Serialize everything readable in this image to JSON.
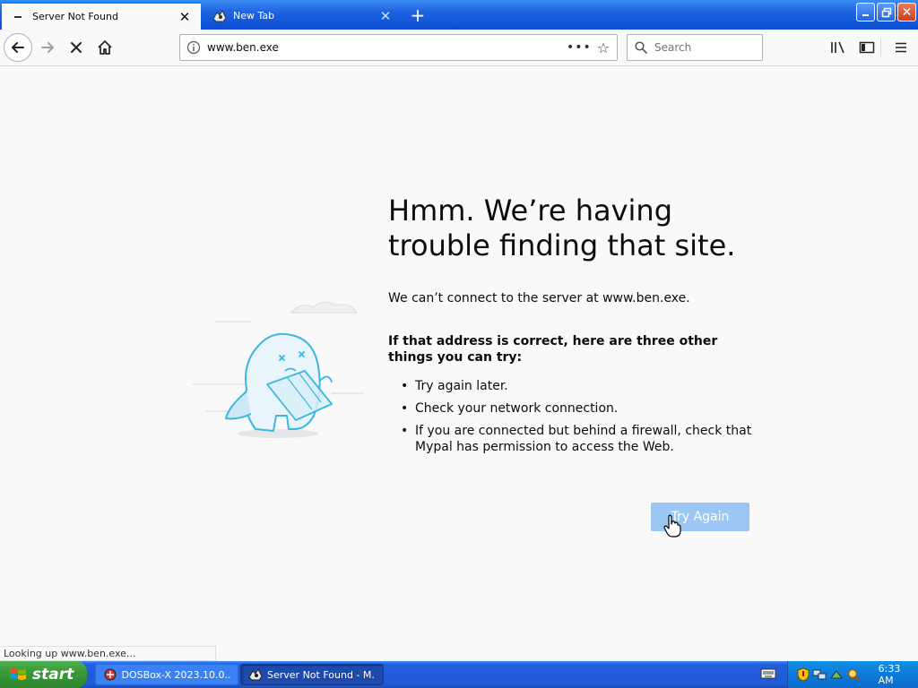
{
  "browser": {
    "tabs": [
      {
        "label": "Server Not Found",
        "active": true
      },
      {
        "label": "New Tab",
        "active": false
      }
    ],
    "new_tab_symbol": "+",
    "url": "www.ben.exe",
    "search_placeholder": "Search",
    "status_text": "Looking up www.ben.exe...",
    "icons": [
      "back-arrow-icon",
      "forward-arrow-icon",
      "stop-icon",
      "home-icon",
      "info-icon",
      "page-actions-icon",
      "bookmark-star-icon",
      "search-icon",
      "library-icon",
      "sidebar-icon",
      "hamburger-menu-icon"
    ]
  },
  "error_page": {
    "title": "Hmm. We’re having trouble finding that site.",
    "description": "We can’t connect to the server at www.ben.exe.",
    "suggestions_heading": "If that address is correct, here are three other things you can try:",
    "suggestions": [
      "Try again later.",
      "Check your network connection.",
      "If you are connected but behind a firewall, check that Mypal has permission to access the Web."
    ],
    "try_again_label": "Try Again",
    "button_color": "#9cc7f5"
  },
  "taskbar": {
    "start_label": "start",
    "tasks": [
      {
        "label": "DOSBox-X 2023.10.0..."
      },
      {
        "label": "Server Not Found - M..."
      }
    ],
    "clock": "6:33 AM"
  },
  "colors": {
    "xp_blue": "#245edb",
    "start_green": "#3a9a3a",
    "accent": "#0a84ff"
  }
}
